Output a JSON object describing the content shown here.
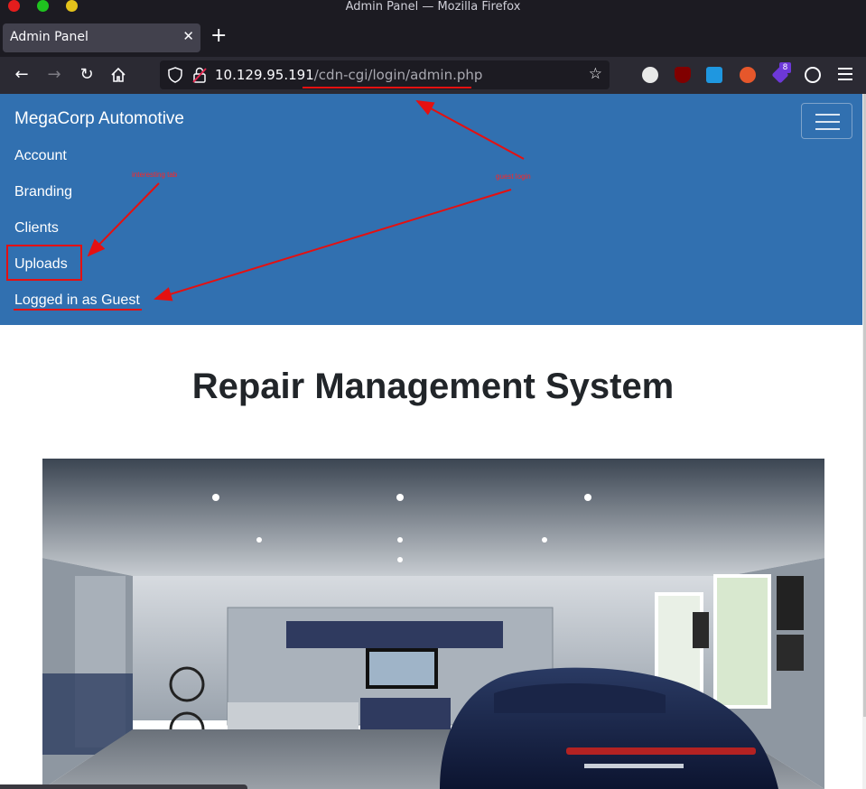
{
  "window": {
    "title": "Admin Panel — Mozilla Firefox"
  },
  "tabs": [
    {
      "label": "Admin Panel",
      "active": true
    }
  ],
  "urlbar": {
    "host": "10.129.95.191",
    "path": "/cdn-cgi/login/admin.php"
  },
  "extensions": {
    "badge_count": "8"
  },
  "site": {
    "brand": "MegaCorp Automotive",
    "nav": [
      {
        "label": "Account"
      },
      {
        "label": "Branding"
      },
      {
        "label": "Clients"
      },
      {
        "label": "Uploads"
      }
    ],
    "login_status": "Logged in as Guest",
    "page_title": "Repair Management System",
    "hero_image": "garage with blue porsche 911 carrera s"
  },
  "annotations": {
    "interesting_tab": "interesting tab",
    "guest_login": "guest login",
    "color": "#e51010"
  },
  "colors": {
    "header_bg": "#3170b0",
    "browser_chrome": "#1c1b22",
    "toolbar": "#2b2a33"
  }
}
